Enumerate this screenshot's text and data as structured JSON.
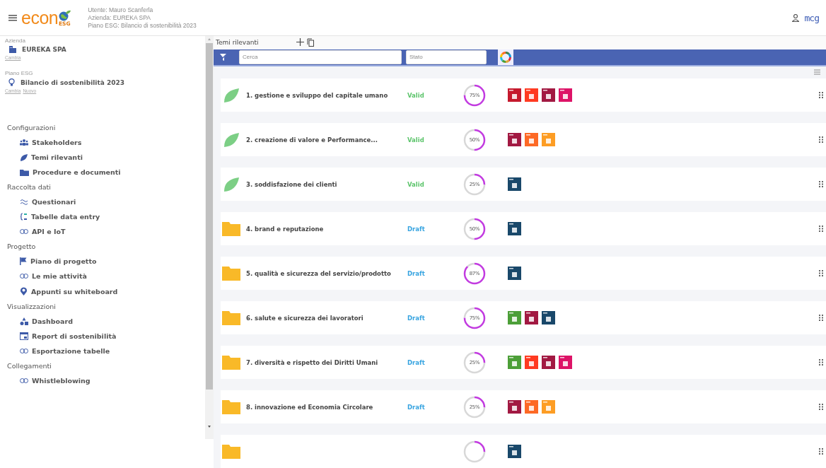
{
  "header": {
    "logo": {
      "word": "econ",
      "badge": "ESG"
    },
    "user_line": "Utente: Mauro Scanferla",
    "company_line": "Azienda: EUREKA SPA",
    "plan_line": "Piano ESG: Bilancio di sostenibilità 2023",
    "brand": "mcg"
  },
  "sidebar": {
    "company": {
      "label": "Azienda",
      "name": "EUREKA SPA",
      "links": [
        "Cambia"
      ]
    },
    "plan": {
      "label": "Piano ESG",
      "name": "Bilancio di sostenibilità 2023",
      "links": [
        "Cambia",
        "Nuovo"
      ]
    },
    "sections": [
      {
        "title": "Configurazioni",
        "items": [
          {
            "label": "Stakeholders",
            "kind": "people"
          },
          {
            "label": "Temi rilevanti",
            "kind": "leaf"
          },
          {
            "label": "Procedure e documenti",
            "kind": "folder"
          }
        ]
      },
      {
        "title": "Raccolta dati",
        "items": [
          {
            "label": "Questionari",
            "kind": "wave"
          },
          {
            "label": "Tabelle data entry",
            "kind": "braces"
          },
          {
            "label": "API e IoT",
            "kind": "link"
          }
        ]
      },
      {
        "title": "Progetto",
        "items": [
          {
            "label": "Piano di progetto",
            "kind": "flag"
          },
          {
            "label": "Le mie attività",
            "kind": "link"
          },
          {
            "label": "Appunti su whiteboard",
            "kind": "pin"
          }
        ]
      },
      {
        "title": "Visualizzazioni",
        "items": [
          {
            "label": "Dashboard",
            "kind": "shapes"
          },
          {
            "label": "Report di sostenibilità",
            "kind": "calendar"
          },
          {
            "label": "Esportazione tabelle",
            "kind": "link"
          }
        ]
      },
      {
        "title": "Collegamenti",
        "items": [
          {
            "label": "Whistleblowing",
            "kind": "link"
          }
        ]
      }
    ]
  },
  "main": {
    "title": "Temi rilevanti",
    "filters": {
      "search_placeholder": "Cerca",
      "status_placeholder": "Stato"
    },
    "topics": [
      {
        "kind": "leaf",
        "title": "1. gestione e sviluppo del capitale umano",
        "status": {
          "label": "Valid",
          "kind": "valid"
        },
        "percent": "75%",
        "level": 0.75,
        "goals": [
          {
            "color": "#c5192d"
          },
          {
            "color": "#ff3a21"
          },
          {
            "color": "#a21942"
          },
          {
            "color": "#dd1367"
          }
        ]
      },
      {
        "kind": "leaf",
        "title": "2. creazione di valore e Performance...",
        "status": {
          "label": "Valid",
          "kind": "valid"
        },
        "percent": "50%",
        "level": 0.5,
        "goals": [
          {
            "color": "#a21942"
          },
          {
            "color": "#fd6925"
          },
          {
            "color": "#fd9d24"
          }
        ]
      },
      {
        "kind": "leaf",
        "title": "3. soddisfazione dei clienti",
        "status": {
          "label": "Valid",
          "kind": "valid"
        },
        "percent": "25%",
        "level": 0.25,
        "goals": [
          {
            "color": "#19486a"
          }
        ]
      },
      {
        "kind": "folder",
        "title": "4. brand e reputazione",
        "status": {
          "label": "Draft",
          "kind": "draft"
        },
        "percent": "50%",
        "level": 0.5,
        "goals": [
          {
            "color": "#19486a"
          }
        ]
      },
      {
        "kind": "folder",
        "title": "5. qualità e sicurezza del servizio/prodotto",
        "status": {
          "label": "Draft",
          "kind": "draft"
        },
        "percent": "87%",
        "level": 0.87,
        "goals": [
          {
            "color": "#19486a"
          }
        ]
      },
      {
        "kind": "folder",
        "title": "6. salute e sicurezza dei lavoratori",
        "status": {
          "label": "Draft",
          "kind": "draft"
        },
        "percent": "75%",
        "level": 0.75,
        "goals": [
          {
            "color": "#4c9f38"
          },
          {
            "color": "#a21942"
          },
          {
            "color": "#19486a"
          }
        ]
      },
      {
        "kind": "folder",
        "title": "7. diversità e rispetto dei Diritti Umani",
        "status": {
          "label": "Draft",
          "kind": "draft"
        },
        "percent": "25%",
        "level": 0.25,
        "goals": [
          {
            "color": "#4c9f38"
          },
          {
            "color": "#ff3a21"
          },
          {
            "color": "#a21942"
          },
          {
            "color": "#dd1367"
          }
        ]
      },
      {
        "kind": "folder",
        "title": "8. innovazione ed Economia Circolare",
        "status": {
          "label": "Draft",
          "kind": "draft"
        },
        "percent": "25%",
        "level": 0.25,
        "goals": [
          {
            "color": "#a21942"
          },
          {
            "color": "#fd6925"
          },
          {
            "color": "#fd9d24"
          }
        ]
      },
      {
        "kind": "folder",
        "level": 0.25,
        "goals": [
          {
            "color": "#19486a"
          }
        ]
      }
    ]
  }
}
